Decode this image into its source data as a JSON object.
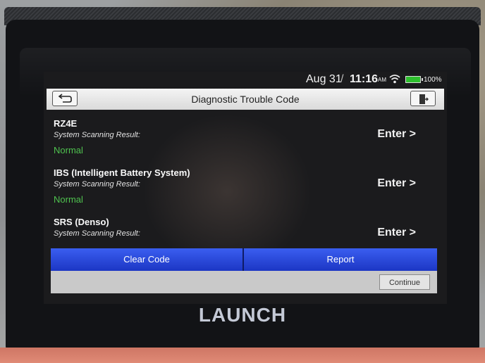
{
  "status_bar": {
    "date": "Aug 31",
    "separator": "/",
    "time": "11:16",
    "ampm": "AM",
    "battery": "100%",
    "battery_color": "#2dbf2d"
  },
  "header": {
    "title": "Diagnostic Trouble Code",
    "back_icon": "back-arrow-icon",
    "exit_icon": "exit-icon"
  },
  "systems": [
    {
      "name": "RZ4E",
      "label": "System Scanning Result:",
      "status": "Normal",
      "action": "Enter >"
    },
    {
      "name": "IBS (Intelligent Battery System)",
      "label": "System Scanning Result:",
      "status": "Normal",
      "action": "Enter >"
    },
    {
      "name": "SRS (Denso)",
      "label": "System Scanning Result:",
      "status": "",
      "action": "Enter >"
    }
  ],
  "actions": {
    "clear_code": "Clear Code",
    "report": "Report",
    "accent": "#2746dc"
  },
  "footer": {
    "continue": "Continue"
  },
  "device": {
    "logo": "LAUNCH"
  }
}
